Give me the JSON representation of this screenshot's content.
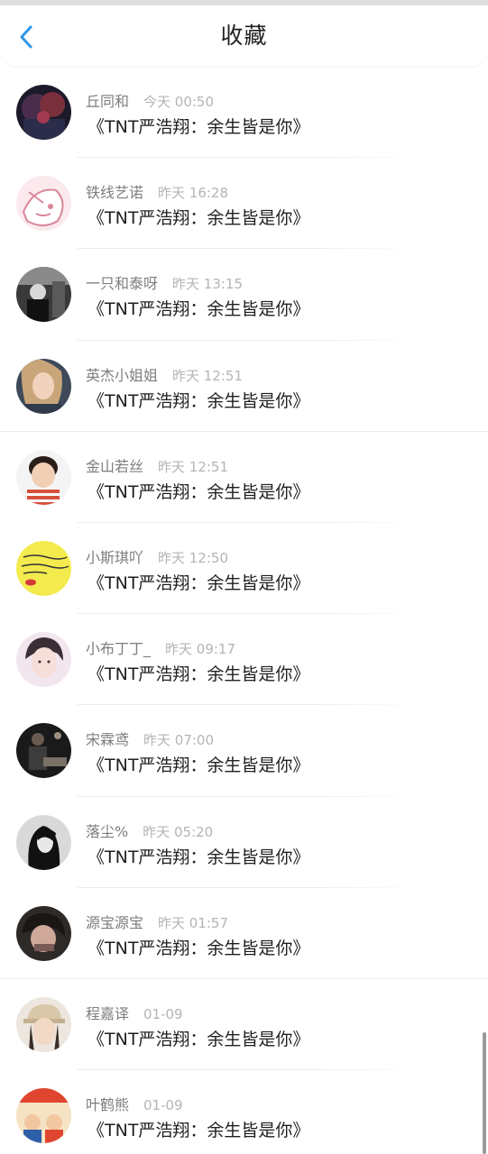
{
  "header": {
    "title": "收藏",
    "back_icon": "chevron-left-icon",
    "accent_color": "#2f97e8"
  },
  "favorites": [
    {
      "name": "丘同和",
      "time": "今天 00:50",
      "title": "《TNT严浩翔：余生皆是你》"
    },
    {
      "name": "铁线艺诺",
      "time": "昨天 16:28",
      "title": "《TNT严浩翔：余生皆是你》"
    },
    {
      "name": "一只和泰呀",
      "time": "昨天 13:15",
      "title": "《TNT严浩翔：余生皆是你》"
    },
    {
      "name": "英杰小姐姐",
      "time": "昨天 12:51",
      "title": "《TNT严浩翔：余生皆是你》"
    },
    {
      "name": "金山若丝",
      "time": "昨天 12:51",
      "title": "《TNT严浩翔：余生皆是你》"
    },
    {
      "name": "小斯琪吖",
      "time": "昨天 12:50",
      "title": "《TNT严浩翔：余生皆是你》"
    },
    {
      "name": "小布丁丁_",
      "time": "昨天 09:17",
      "title": "《TNT严浩翔：余生皆是你》"
    },
    {
      "name": "宋霖鸢",
      "time": "昨天 07:00",
      "title": "《TNT严浩翔：余生皆是你》"
    },
    {
      "name": "落尘%",
      "time": "昨天 05:20",
      "title": "《TNT严浩翔：余生皆是你》"
    },
    {
      "name": "源宝源宝",
      "time": "昨天 01:57",
      "title": "《TNT严浩翔：余生皆是你》"
    },
    {
      "name": "程嘉译",
      "time": "01-09",
      "title": "《TNT严浩翔：余生皆是你》"
    },
    {
      "name": "叶鹤熊",
      "time": "01-09",
      "title": "《TNT严浩翔：余生皆是你》"
    }
  ]
}
